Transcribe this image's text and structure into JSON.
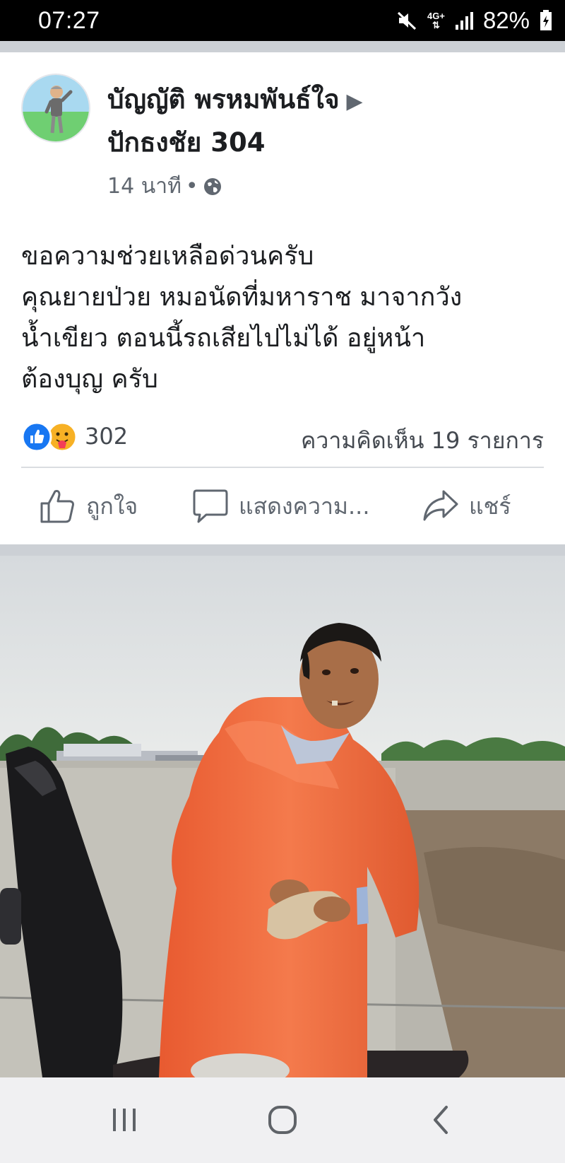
{
  "status_bar": {
    "time": "07:27",
    "network": "4G+",
    "battery": "82%",
    "icons": [
      "mute-icon",
      "signal-icon",
      "battery-icon"
    ]
  },
  "post": {
    "author_line1": "บัญญัติ พรหมพันธ์ใจ",
    "author_line2": "ปักธงชัย 304",
    "time_ago": "14 นาที",
    "meta_separator": "•",
    "privacy_icon": "globe-icon",
    "body": "ขอความช่วยเหลือด่วนครับ\nคุณยายป่วย หมอนัดที่มหาราช มาจากวัง\nน้ำเขียว ตอนนี้รถเสียไปไม่ได้ อยู่หน้า\nต้องบุญ ครับ",
    "reactions_count": "302",
    "comments_label": "ความคิดเห็น 19 รายการ"
  },
  "actions": {
    "like": "ถูกใจ",
    "comment": "แสดงความ...",
    "share": "แชร์"
  },
  "colors": {
    "like_blue": "#1877f2",
    "care_yellow": "#f7b125",
    "separator": "#ccd0d5",
    "raincoat": "#f2693c"
  }
}
